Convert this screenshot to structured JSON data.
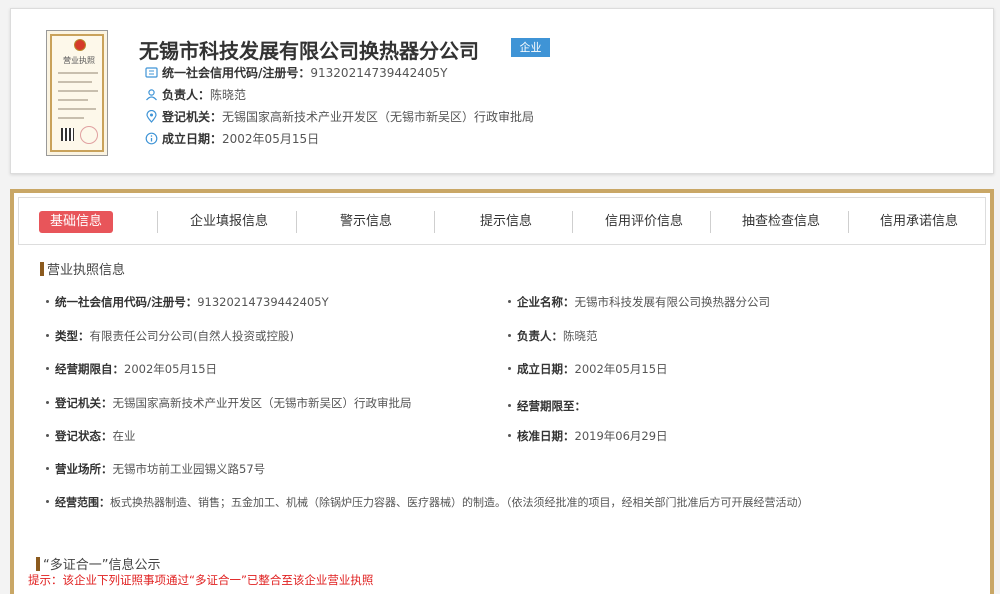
{
  "header": {
    "company_name": "无锡市科技发展有限公司换热器分公司",
    "badge": "企业",
    "license_title": "营业执照",
    "credit_code_label": "统一社会信用代码/注册号：",
    "credit_code_value": "91320214739442405Y",
    "person_label": "负责人：",
    "person_value": "陈晓范",
    "authority_label": "登记机关：",
    "authority_value": "无锡国家高新技术产业开发区（无锡市新吴区）行政审批局",
    "date_label": "成立日期：",
    "date_value": "2002年05月15日"
  },
  "tabs": [
    {
      "label": "基础信息",
      "active": true
    },
    {
      "label": "企业填报信息",
      "active": false
    },
    {
      "label": "警示信息",
      "active": false
    },
    {
      "label": "提示信息",
      "active": false
    },
    {
      "label": "信用评价信息",
      "active": false
    },
    {
      "label": "抽查检查信息",
      "active": false
    },
    {
      "label": "信用承诺信息",
      "active": false
    }
  ],
  "license_section": {
    "title": "营业执照信息",
    "fields": {
      "credit_code": {
        "label": "统一社会信用代码/注册号：",
        "value": "91320214739442405Y"
      },
      "company": {
        "label": "企业名称：",
        "value": "无锡市科技发展有限公司换热器分公司"
      },
      "type": {
        "label": "类型：",
        "value": "有限责任公司分公司(自然人投资或控股)"
      },
      "person": {
        "label": "负责人：",
        "value": "陈晓范"
      },
      "period_from": {
        "label": "经营期限自：",
        "value": "2002年05月15日"
      },
      "founded": {
        "label": "成立日期：",
        "value": "2002年05月15日"
      },
      "authority": {
        "label": "登记机关：",
        "value": "无锡国家高新技术产业开发区（无锡市新吴区）行政审批局"
      },
      "period_to": {
        "label": "经营期限至：",
        "value": ""
      },
      "status": {
        "label": "登记状态：",
        "value": "在业"
      },
      "approved": {
        "label": "核准日期：",
        "value": "2019年06月29日"
      },
      "address": {
        "label": "营业场所：",
        "value": "无锡市坊前工业园锡义路57号"
      },
      "scope": {
        "label": "经营范围：",
        "value": "板式换热器制造、销售；五金加工、机械（除锅炉压力容器、医疗器械）的制造。（依法须经批准的项目，经相关部门批准后方可开展经营活动）"
      }
    }
  },
  "multi_cert_section": {
    "title": "“多证合一”信息公示",
    "tip": "提示：该企业下列证照事项通过“多证合一”已整合至该企业营业执照"
  },
  "colors": {
    "accent_gold": "#c9a766",
    "active_tab": "#e8555a",
    "badge_blue": "#3f94d6",
    "tip_red": "#e02020"
  }
}
